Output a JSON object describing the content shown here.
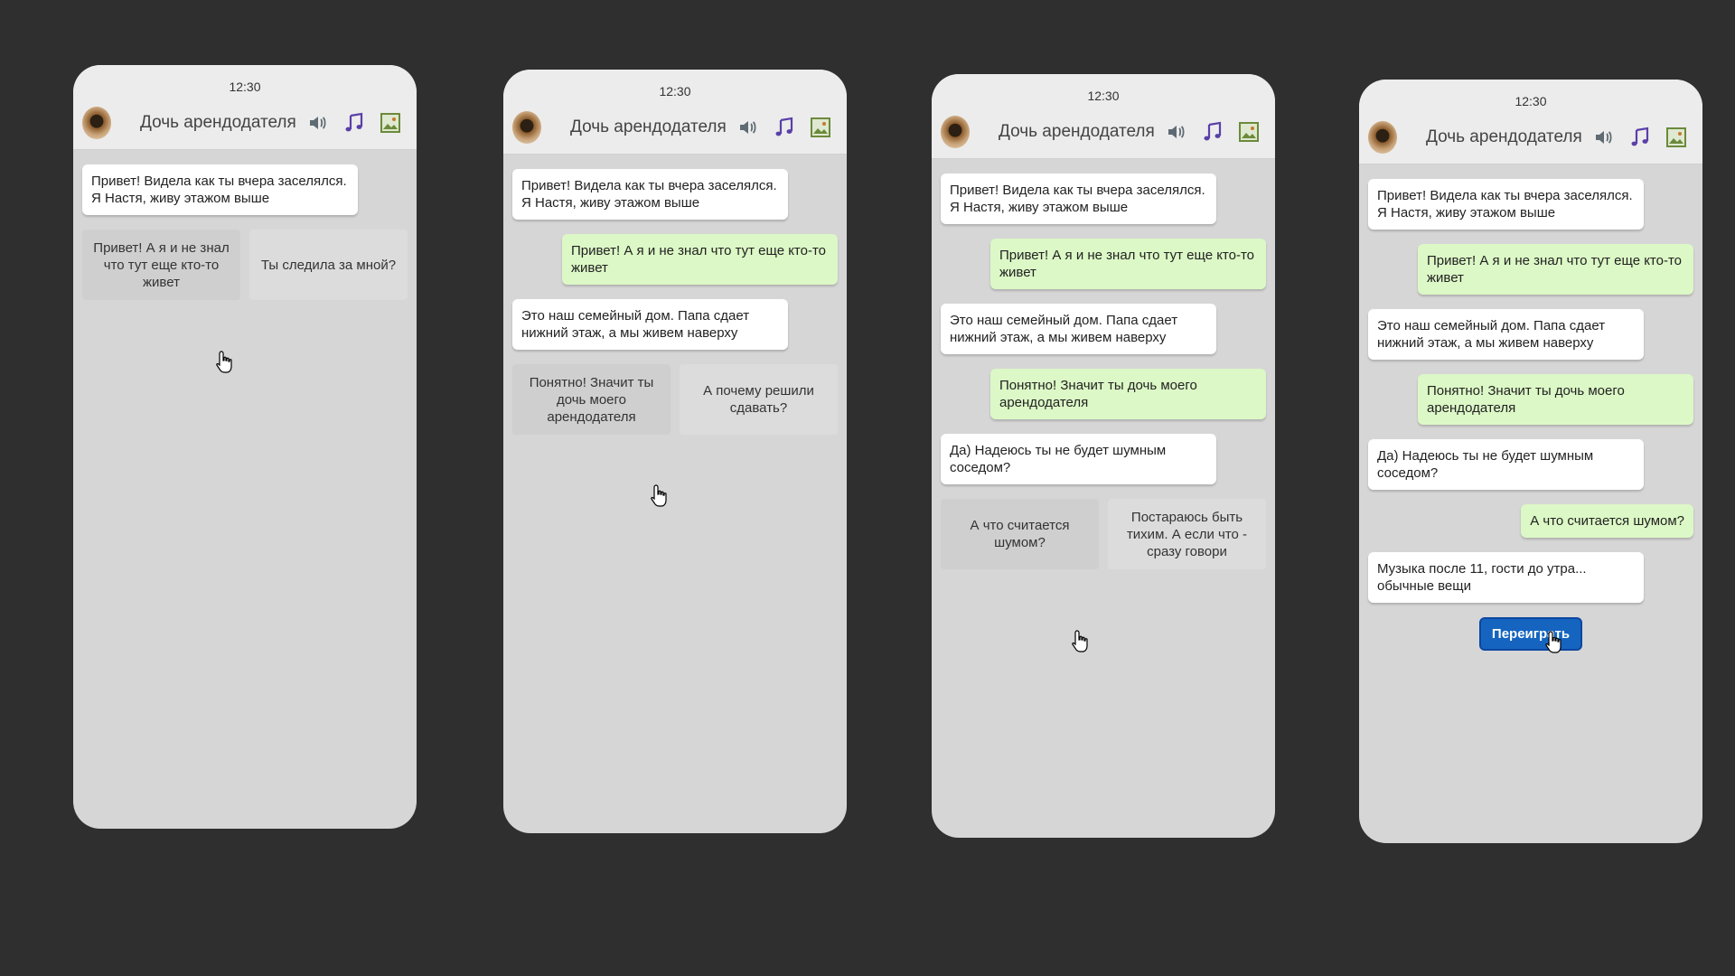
{
  "colors": {
    "background": "#2f2f2f",
    "phone": "#d6d6d6",
    "incoming_bubble": "#ffffff",
    "outgoing_bubble": "#dcf8c6",
    "choice": "#dcdcdc",
    "replay_button": "#1565c0"
  },
  "icons": [
    "speaker-icon",
    "music-note-icon",
    "image-icon",
    "hand-cursor-icon"
  ],
  "screens": [
    {
      "time": "12:30",
      "title": "Дочь арендодателя",
      "messages": [
        {
          "text": "Привет! Видела как ты вчера заселялся.\nЯ Настя, живу этажом выше"
        }
      ],
      "choices": [
        "Привет! А я и не знал\nчто тут еще кто-то\nживет",
        "Ты следила за мной?"
      ]
    },
    {
      "time": "12:30",
      "title": "Дочь арендодателя",
      "messages": [
        {
          "text": "Привет! Видела как ты вчера заселялся.\nЯ Настя, живу этажом выше"
        },
        {
          "text": "Привет! А я и не знал что тут еще кто-то\nживет"
        },
        {
          "text": "Это наш семейный дом. Папа сдает\nнижний этаж, а мы живем наверху"
        }
      ],
      "choices": [
        "Понятно! Значит ты\nдочь моего\nарендодателя",
        "А почему решили\nсдавать?"
      ]
    },
    {
      "time": "12:30",
      "title": "Дочь арендодателя",
      "messages": [
        {
          "text": "Привет! Видела как ты вчера заселялся.\nЯ Настя, живу этажом выше"
        },
        {
          "text": "Привет! А я и не знал что тут еще кто-то\nживет"
        },
        {
          "text": "Это наш семейный дом. Папа сдает\nнижний этаж, а мы живем наверху"
        },
        {
          "text": "Понятно! Значит ты дочь моего\nарендодателя"
        },
        {
          "text": "Да) Надеюсь ты не будет шумным\nсоседом?"
        }
      ],
      "choices": [
        "А что считается\nшумом?",
        "Постараюсь быть\nтихим. А если что -\nсразу говори"
      ]
    },
    {
      "time": "12:30",
      "title": "Дочь арендодателя",
      "messages": [
        {
          "text": "Привет! Видела как ты вчера заселялся.\nЯ Настя, живу этажом выше"
        },
        {
          "text": "Привет! А я и не знал что тут еще кто-то\nживет"
        },
        {
          "text": "Это наш семейный дом. Папа сдает\nнижний этаж, а мы живем наверху"
        },
        {
          "text": "Понятно! Значит ты дочь моего\nарендодателя"
        },
        {
          "text": "Да) Надеюсь ты не будет шумным\nсоседом?"
        },
        {
          "text": "А что считается шумом?"
        },
        {
          "text": "Музыка после 11, гости до утра...\nобычные вещи"
        }
      ],
      "replay_label": "Переиграть"
    }
  ]
}
